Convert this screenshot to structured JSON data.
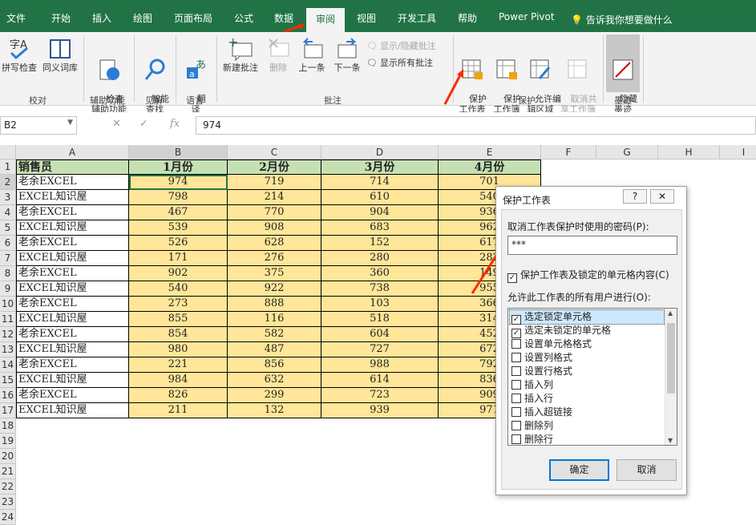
{
  "tabs": [
    "文件",
    "开始",
    "插入",
    "绘图",
    "页面布局",
    "公式",
    "数据",
    "审阅",
    "视图",
    "开发工具",
    "帮助",
    "Power Pivot"
  ],
  "tell_me": "告诉我你想要做什么",
  "ribbon": {
    "spelling": "拼写检查",
    "thesaurus": "同义词库",
    "proofing": "校对",
    "check_access": "检查\n辅助功能",
    "accessibility": "辅助功能",
    "smart_lookup": "智能\n查找",
    "insights": "见解",
    "translate": "翻\n译",
    "language": "语言",
    "new_comment": "新建批注",
    "delete": "删除",
    "previous": "上一条",
    "next": "下一条",
    "show_hide_comment": "显示/隐藏批注",
    "show_all_comments": "显示所有批注",
    "comments": "批注",
    "protect_sheet": "保护\n工作表",
    "protect_workbook": "保护\n工作簿",
    "allow_edit": "允许编\n辑区域",
    "unshare": "取消共\n享工作簿",
    "protect": "保护",
    "hide_ink": "隐藏\n墨迹",
    "ink": "墨迹"
  },
  "formula_bar": {
    "name_box": "B2",
    "formula": "974",
    "fx": "fx"
  },
  "columns": [
    "A",
    "B",
    "C",
    "D",
    "E",
    "F",
    "G",
    "H",
    "I"
  ],
  "rows": [
    "1",
    "2",
    "3",
    "4",
    "5",
    "6",
    "7",
    "8",
    "9",
    "10",
    "11",
    "12",
    "13",
    "14",
    "15",
    "16",
    "17",
    "18",
    "19",
    "20",
    "21",
    "22",
    "23",
    "24"
  ],
  "table": {
    "headers": [
      "销售员",
      "1月份",
      "2月份",
      "3月份",
      "4月份"
    ],
    "data": [
      [
        "老余EXCEL",
        "974",
        "719",
        "714",
        "701"
      ],
      [
        "EXCEL知识屋",
        "798",
        "214",
        "610",
        "540"
      ],
      [
        "老余EXCEL",
        "467",
        "770",
        "904",
        "936"
      ],
      [
        "EXCEL知识屋",
        "539",
        "908",
        "683",
        "962"
      ],
      [
        "老余EXCEL",
        "526",
        "628",
        "152",
        "617"
      ],
      [
        "EXCEL知识屋",
        "171",
        "276",
        "280",
        "282"
      ],
      [
        "老余EXCEL",
        "902",
        "375",
        "360",
        "149"
      ],
      [
        "EXCEL知识屋",
        "540",
        "922",
        "738",
        "955"
      ],
      [
        "老余EXCEL",
        "273",
        "888",
        "103",
        "366"
      ],
      [
        "EXCEL知识屋",
        "855",
        "116",
        "518",
        "314"
      ],
      [
        "老余EXCEL",
        "854",
        "582",
        "604",
        "452"
      ],
      [
        "EXCEL知识屋",
        "980",
        "487",
        "727",
        "672"
      ],
      [
        "老余EXCEL",
        "221",
        "856",
        "988",
        "792"
      ],
      [
        "EXCEL知识屋",
        "984",
        "632",
        "614",
        "836"
      ],
      [
        "老余EXCEL",
        "826",
        "299",
        "723",
        "909"
      ],
      [
        "EXCEL知识屋",
        "211",
        "132",
        "939",
        "971"
      ]
    ]
  },
  "dialog": {
    "title": "保护工作表",
    "help": "?",
    "close": "✕",
    "password_label": "取消工作表保护时使用的密码(P):",
    "password_value": "***",
    "protect_check_label": "保护工作表及锁定的单元格内容(C)",
    "allow_label": "允许此工作表的所有用户进行(O):",
    "options": [
      {
        "label": "选定锁定单元格",
        "checked": true
      },
      {
        "label": "选定未锁定的单元格",
        "checked": true
      },
      {
        "label": "设置单元格格式",
        "checked": false
      },
      {
        "label": "设置列格式",
        "checked": false
      },
      {
        "label": "设置行格式",
        "checked": false
      },
      {
        "label": "插入列",
        "checked": false
      },
      {
        "label": "插入行",
        "checked": false
      },
      {
        "label": "插入超链接",
        "checked": false
      },
      {
        "label": "删除列",
        "checked": false
      },
      {
        "label": "删除行",
        "checked": false
      }
    ],
    "ok": "确定",
    "cancel": "取消"
  },
  "colors": {
    "excel_green": "#217346",
    "header_fill": "#c6e0b4",
    "data_fill": "#ffe699",
    "arrow": "#ff2a00"
  }
}
